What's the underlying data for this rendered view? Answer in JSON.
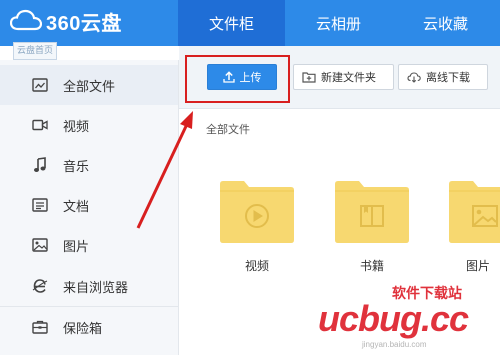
{
  "brand": {
    "name": "360云盘",
    "sublabel": "云盘首页"
  },
  "nav": {
    "tabs": [
      {
        "label": "文件柜",
        "active": true
      },
      {
        "label": "云相册",
        "active": false
      },
      {
        "label": "云收藏",
        "active": false
      }
    ]
  },
  "sidebar": {
    "items": [
      {
        "label": "全部文件",
        "icon": "all-files-icon",
        "active": true
      },
      {
        "label": "视频",
        "icon": "video-icon",
        "active": false
      },
      {
        "label": "音乐",
        "icon": "music-icon",
        "active": false
      },
      {
        "label": "文档",
        "icon": "document-icon",
        "active": false
      },
      {
        "label": "图片",
        "icon": "image-icon",
        "active": false
      },
      {
        "label": "来自浏览器",
        "icon": "browser-icon",
        "active": false
      },
      {
        "label": "保险箱",
        "icon": "safe-icon",
        "active": false
      }
    ]
  },
  "toolbar": {
    "upload_label": "上传",
    "new_folder_label": "新建文件夹",
    "offline_download_label": "离线下载"
  },
  "breadcrumb": {
    "label": "全部文件"
  },
  "folders": [
    {
      "label": "视频",
      "icon": "play-icon"
    },
    {
      "label": "书籍",
      "icon": "book-icon"
    },
    {
      "label": "图片",
      "icon": "picture-icon"
    }
  ],
  "watermark": {
    "title": "软件下载站",
    "logo": "ucbug.cc",
    "url": "jingyan.baidu.com"
  },
  "colors": {
    "brand_blue": "#2d8ae8",
    "active_tab": "#1f6ed6",
    "folder_yellow": "#f7d870",
    "annotation_red": "#d81f1f"
  }
}
